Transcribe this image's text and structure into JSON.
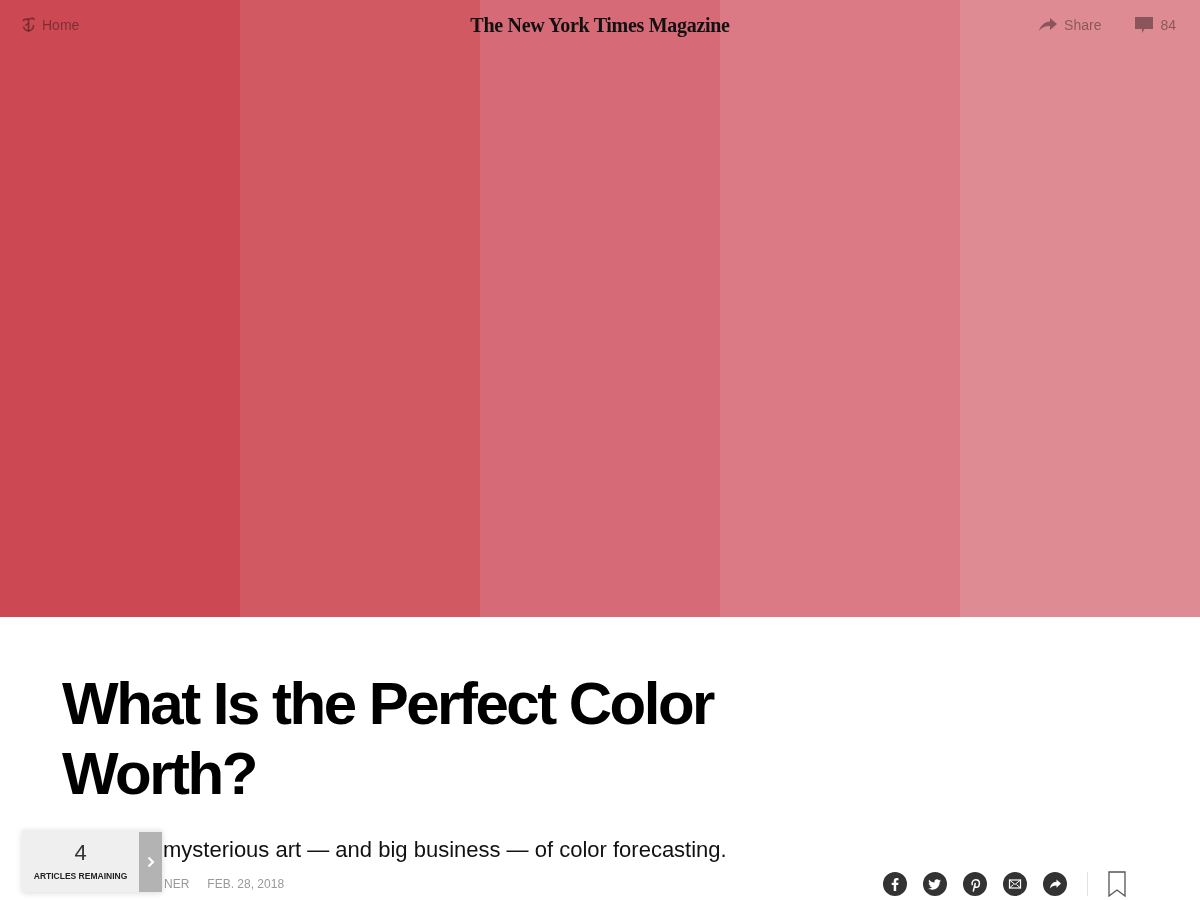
{
  "header": {
    "home": {
      "label": "Home"
    },
    "logo": "The New York Times Magazine",
    "share": {
      "label": "Share"
    },
    "comments": {
      "count": "84"
    }
  },
  "hero": {
    "stripes": [
      {
        "color": "#cc4954"
      },
      {
        "color": "#d05962"
      },
      {
        "color": "#d66a76"
      },
      {
        "color": "#db7a84"
      },
      {
        "color": "#df8b93"
      }
    ]
  },
  "article": {
    "headline": "What Is the Perfect Color Worth?",
    "summary": "mysterious art — and big business — of color forecasting.",
    "byline": "NER",
    "date": "FEB. 28, 2018"
  },
  "meter": {
    "count": "4",
    "label": "ARTICLES REMAINING"
  }
}
